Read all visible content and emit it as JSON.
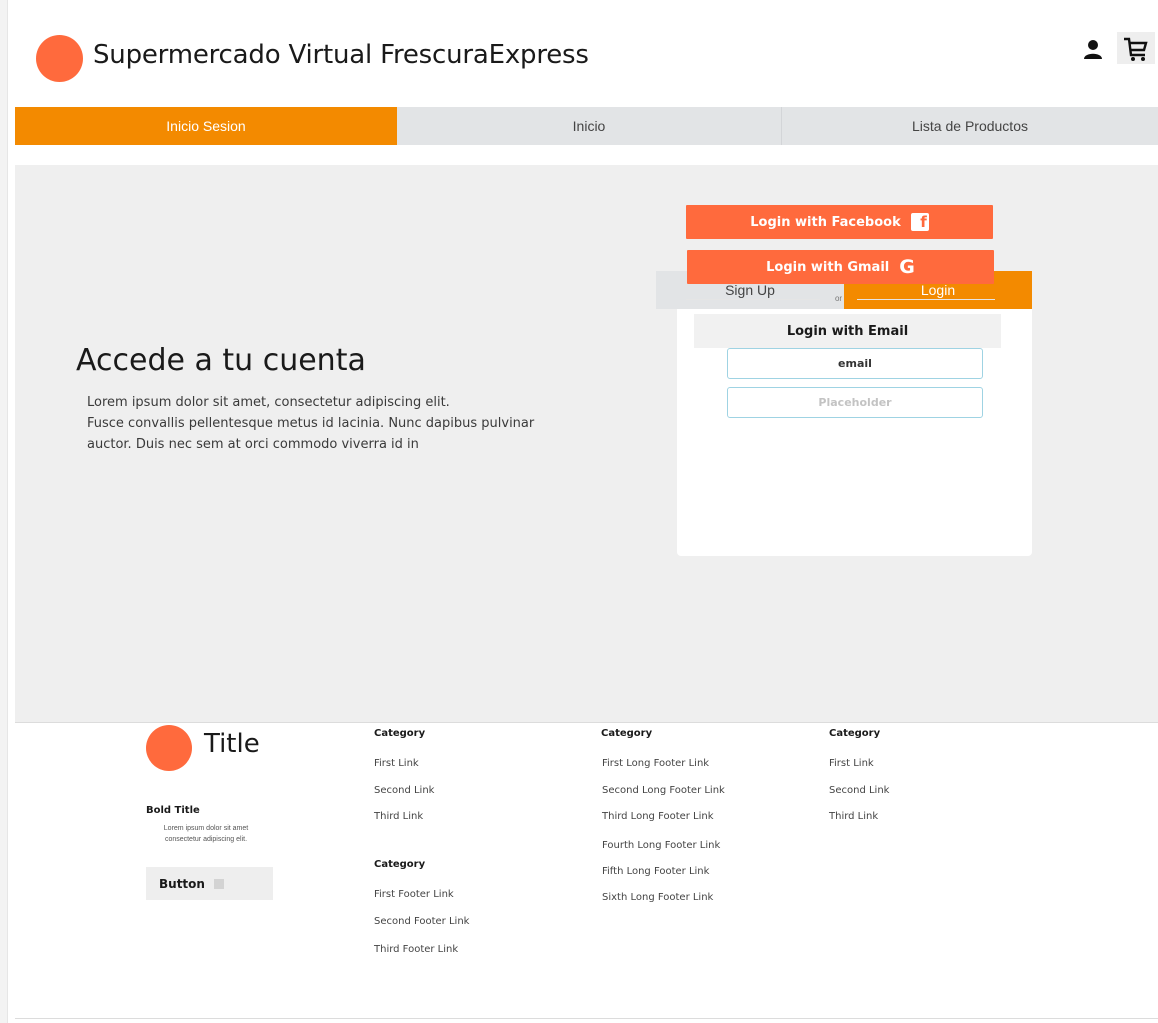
{
  "header": {
    "title": "Supermercado Virtual FrescuraExpress",
    "icons": [
      "user-icon",
      "cart-icon"
    ]
  },
  "nav": {
    "tabs": [
      {
        "label": "Inicio Sesion",
        "active": true
      },
      {
        "label": "Inicio",
        "active": false
      },
      {
        "label": "Lista de Productos",
        "active": false
      }
    ]
  },
  "hero": {
    "title": "Accede a tu cuenta",
    "lines": [
      "Lorem ipsum dolor sit amet, consectetur adipiscing elit.",
      "Fusce convallis pellentesque metus id lacinia. Nunc dapibus pulvinar",
      "auctor. Duis nec sem at orci commodo viverra id in"
    ]
  },
  "auth": {
    "tabs": [
      {
        "label": "Sign Up",
        "active": false
      },
      {
        "label": "Login",
        "active": true
      }
    ],
    "facebook_label": "Login with Facebook",
    "gmail_label": "Login with Gmail",
    "or_label": "or",
    "email_header": "Login with Email",
    "email_placeholder": "email",
    "password_placeholder": "Placeholder"
  },
  "footer": {
    "title": "Title",
    "bold_title": "Bold Title",
    "description": "Lorem ipsum dolor sit amet consectetur adipiscing elit.",
    "button_label": "Button",
    "columns": [
      {
        "category": "Category",
        "links": [
          "First Link",
          "Second Link",
          "Third Link"
        ]
      },
      {
        "category": "Category",
        "links": [
          "First Footer Link",
          "Second Footer Link",
          "Third Footer Link"
        ]
      },
      {
        "category": "Category",
        "links": [
          "First Long Footer Link",
          "Second Long Footer Link",
          "Third Long Footer Link",
          "Fourth Long Footer Link",
          "Fifth Long Footer Link",
          "Sixth Long Footer Link"
        ]
      },
      {
        "category": "Category",
        "links": [
          "First Link",
          "Second Link",
          "Third Link"
        ]
      }
    ]
  },
  "colors": {
    "accent_orange": "#f38a00",
    "brand_coral": "#ff6a3d",
    "tab_gray": "#e2e4e6",
    "hero_bg": "#efefef"
  }
}
